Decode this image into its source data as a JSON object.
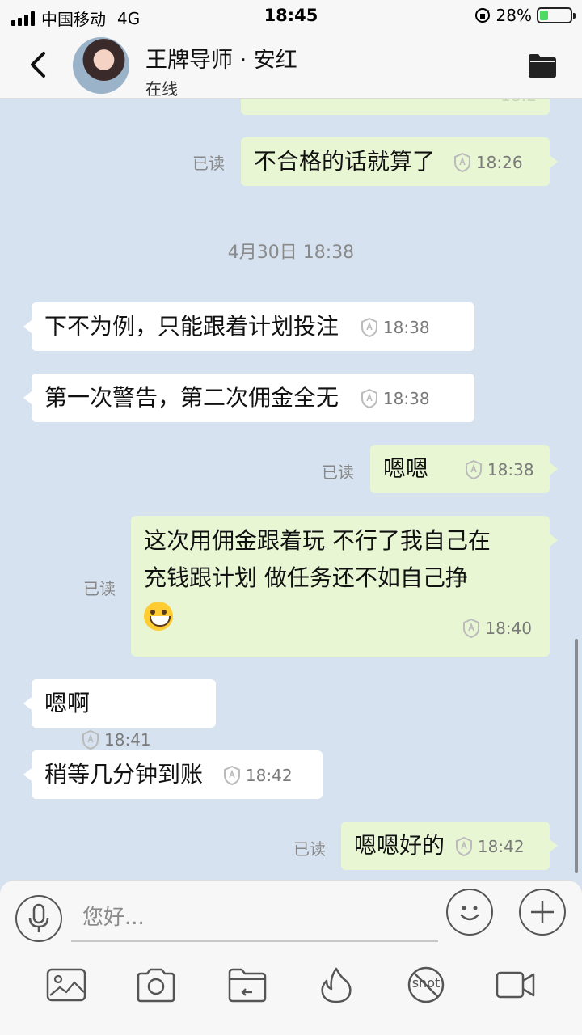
{
  "status_bar": {
    "carrier": "中国移动",
    "network": "4G",
    "time": "18:45",
    "battery": "28%",
    "battery_level": 0.28
  },
  "header": {
    "title": "王牌导师 · 安红",
    "status": "在线",
    "back_icon": "chevron-left-icon",
    "folder_icon": "folder-icon"
  },
  "chat": {
    "partial_message_time": "18:2",
    "date_separator": "4月30日 18:38",
    "read_label": "已读",
    "messages": [
      {
        "dir": "out",
        "text": "不合格的话就算了",
        "time": "18:26",
        "read": "已读"
      },
      {
        "dir": "in",
        "text": "下不为例，只能跟着计划投注",
        "time": "18:38"
      },
      {
        "dir": "in",
        "text": "第一次警告，第二次佣金全无",
        "time": "18:38"
      },
      {
        "dir": "out",
        "text": "嗯嗯",
        "time": "18:38",
        "read": "已读"
      },
      {
        "dir": "out",
        "text_line1": "这次用佣金跟着玩   不行了我自己在",
        "text_line2": "充钱跟计划   做任务还不如自己挣",
        "emoji": "grinning-face-emoji",
        "time": "18:40",
        "read": "已读"
      },
      {
        "dir": "in",
        "text": "嗯啊",
        "time": "18:41"
      },
      {
        "dir": "in",
        "text": "稍等几分钟到账",
        "time": "18:42"
      },
      {
        "dir": "out",
        "text": "嗯嗯好的",
        "time": "18:42",
        "read": "已读"
      }
    ]
  },
  "input_bar": {
    "placeholder": "您好...",
    "icons": [
      "microphone-icon",
      "emoji-icon",
      "plus-icon",
      "image-icon",
      "camera-icon",
      "folder-upload-icon",
      "fire-icon",
      "no-screenshot-icon",
      "video-call-icon"
    ],
    "shot_label": "shot"
  }
}
